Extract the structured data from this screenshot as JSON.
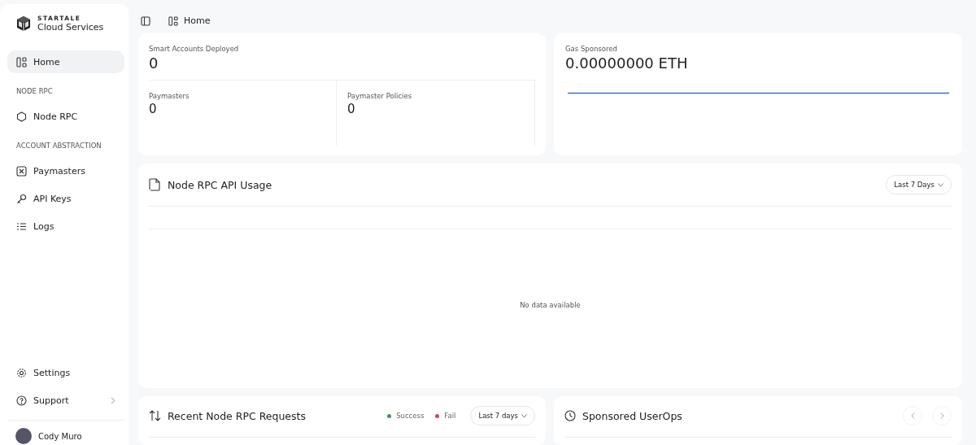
{
  "sidebar": {
    "logo": {
      "brand": "STARTALE",
      "product": "Cloud Services"
    },
    "items": [
      {
        "kind": "link",
        "label": "Home",
        "selected": true
      },
      {
        "kind": "section",
        "label": "NODE RPC"
      },
      {
        "kind": "link",
        "label": "Node RPC",
        "selected": false
      },
      {
        "kind": "section",
        "label": "ACCOUNT ABSTRACTION"
      },
      {
        "kind": "link",
        "label": "Paymasters",
        "selected": false
      },
      {
        "kind": "link",
        "label": "API Keys",
        "selected": false
      },
      {
        "kind": "link",
        "label": "Logs",
        "selected": false
      }
    ],
    "footer_items": [
      {
        "label": "Settings",
        "has_submenu": false
      },
      {
        "label": "Support",
        "has_submenu": true
      }
    ],
    "user": {
      "name": "Cody Muro"
    }
  },
  "breadcrumb": {
    "label": "Home"
  },
  "stats": {
    "main": {
      "label": "Smart Accounts Deployed",
      "value": "0"
    },
    "sub": [
      {
        "label": "Paymasters",
        "value": "0"
      },
      {
        "label": "Paymaster Policies",
        "value": "0"
      }
    ]
  },
  "gas": {
    "label": "Gas Sponsored",
    "value": "0.00000000 ETH"
  },
  "usage": {
    "title": "Node RPC API Usage",
    "range": "Last 7 Days",
    "empty_text": "No data available"
  },
  "requests": {
    "title": "Recent Node RPC Requests",
    "legend": [
      {
        "label": "Success",
        "color": "#3a9a4a"
      },
      {
        "label": "Fail",
        "color": "#e0404a"
      }
    ],
    "range": "Last 7 days"
  },
  "userops": {
    "title": "Sponsored UserOps"
  }
}
